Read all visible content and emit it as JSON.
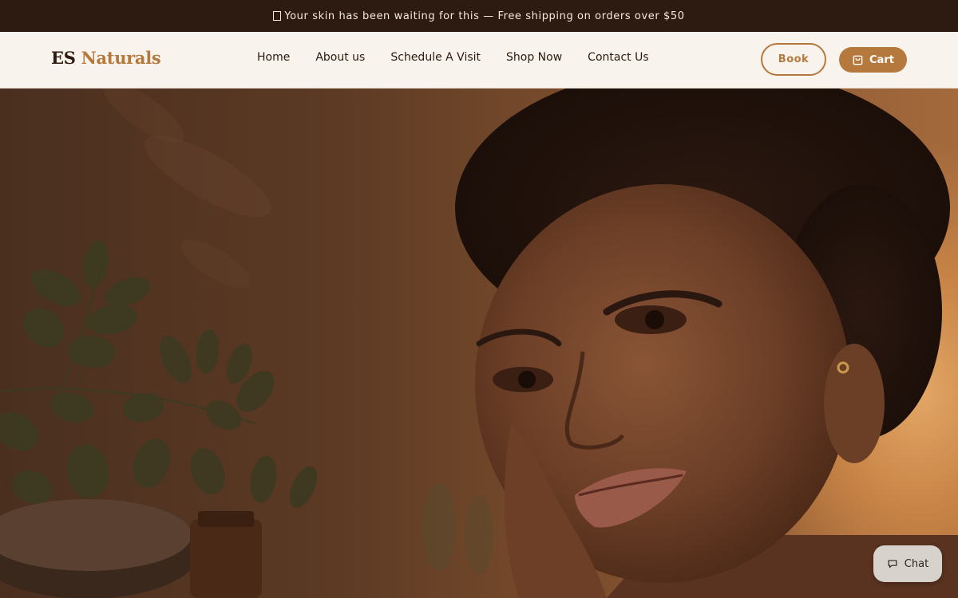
{
  "announcement": {
    "icon": "sparkle-icon",
    "text": "Your skin has been waiting for this — Free shipping on orders over $50"
  },
  "header": {
    "logo": {
      "part1": "ES",
      "part2": "Naturals"
    },
    "nav": [
      {
        "label": "Home"
      },
      {
        "label": "About us"
      },
      {
        "label": "Schedule A Visit"
      },
      {
        "label": "Shop Now"
      },
      {
        "label": "Contact Us"
      }
    ],
    "book_label": "Book",
    "cart_label": "Cart"
  },
  "hero": {
    "image": "woman-portrait-with-plants"
  },
  "chat": {
    "label": "Chat",
    "icon": "chat-bubble-icon"
  },
  "colors": {
    "brand": "#b6793d",
    "dark": "#2d1a10",
    "nav_bg": "#f8f3ec"
  }
}
